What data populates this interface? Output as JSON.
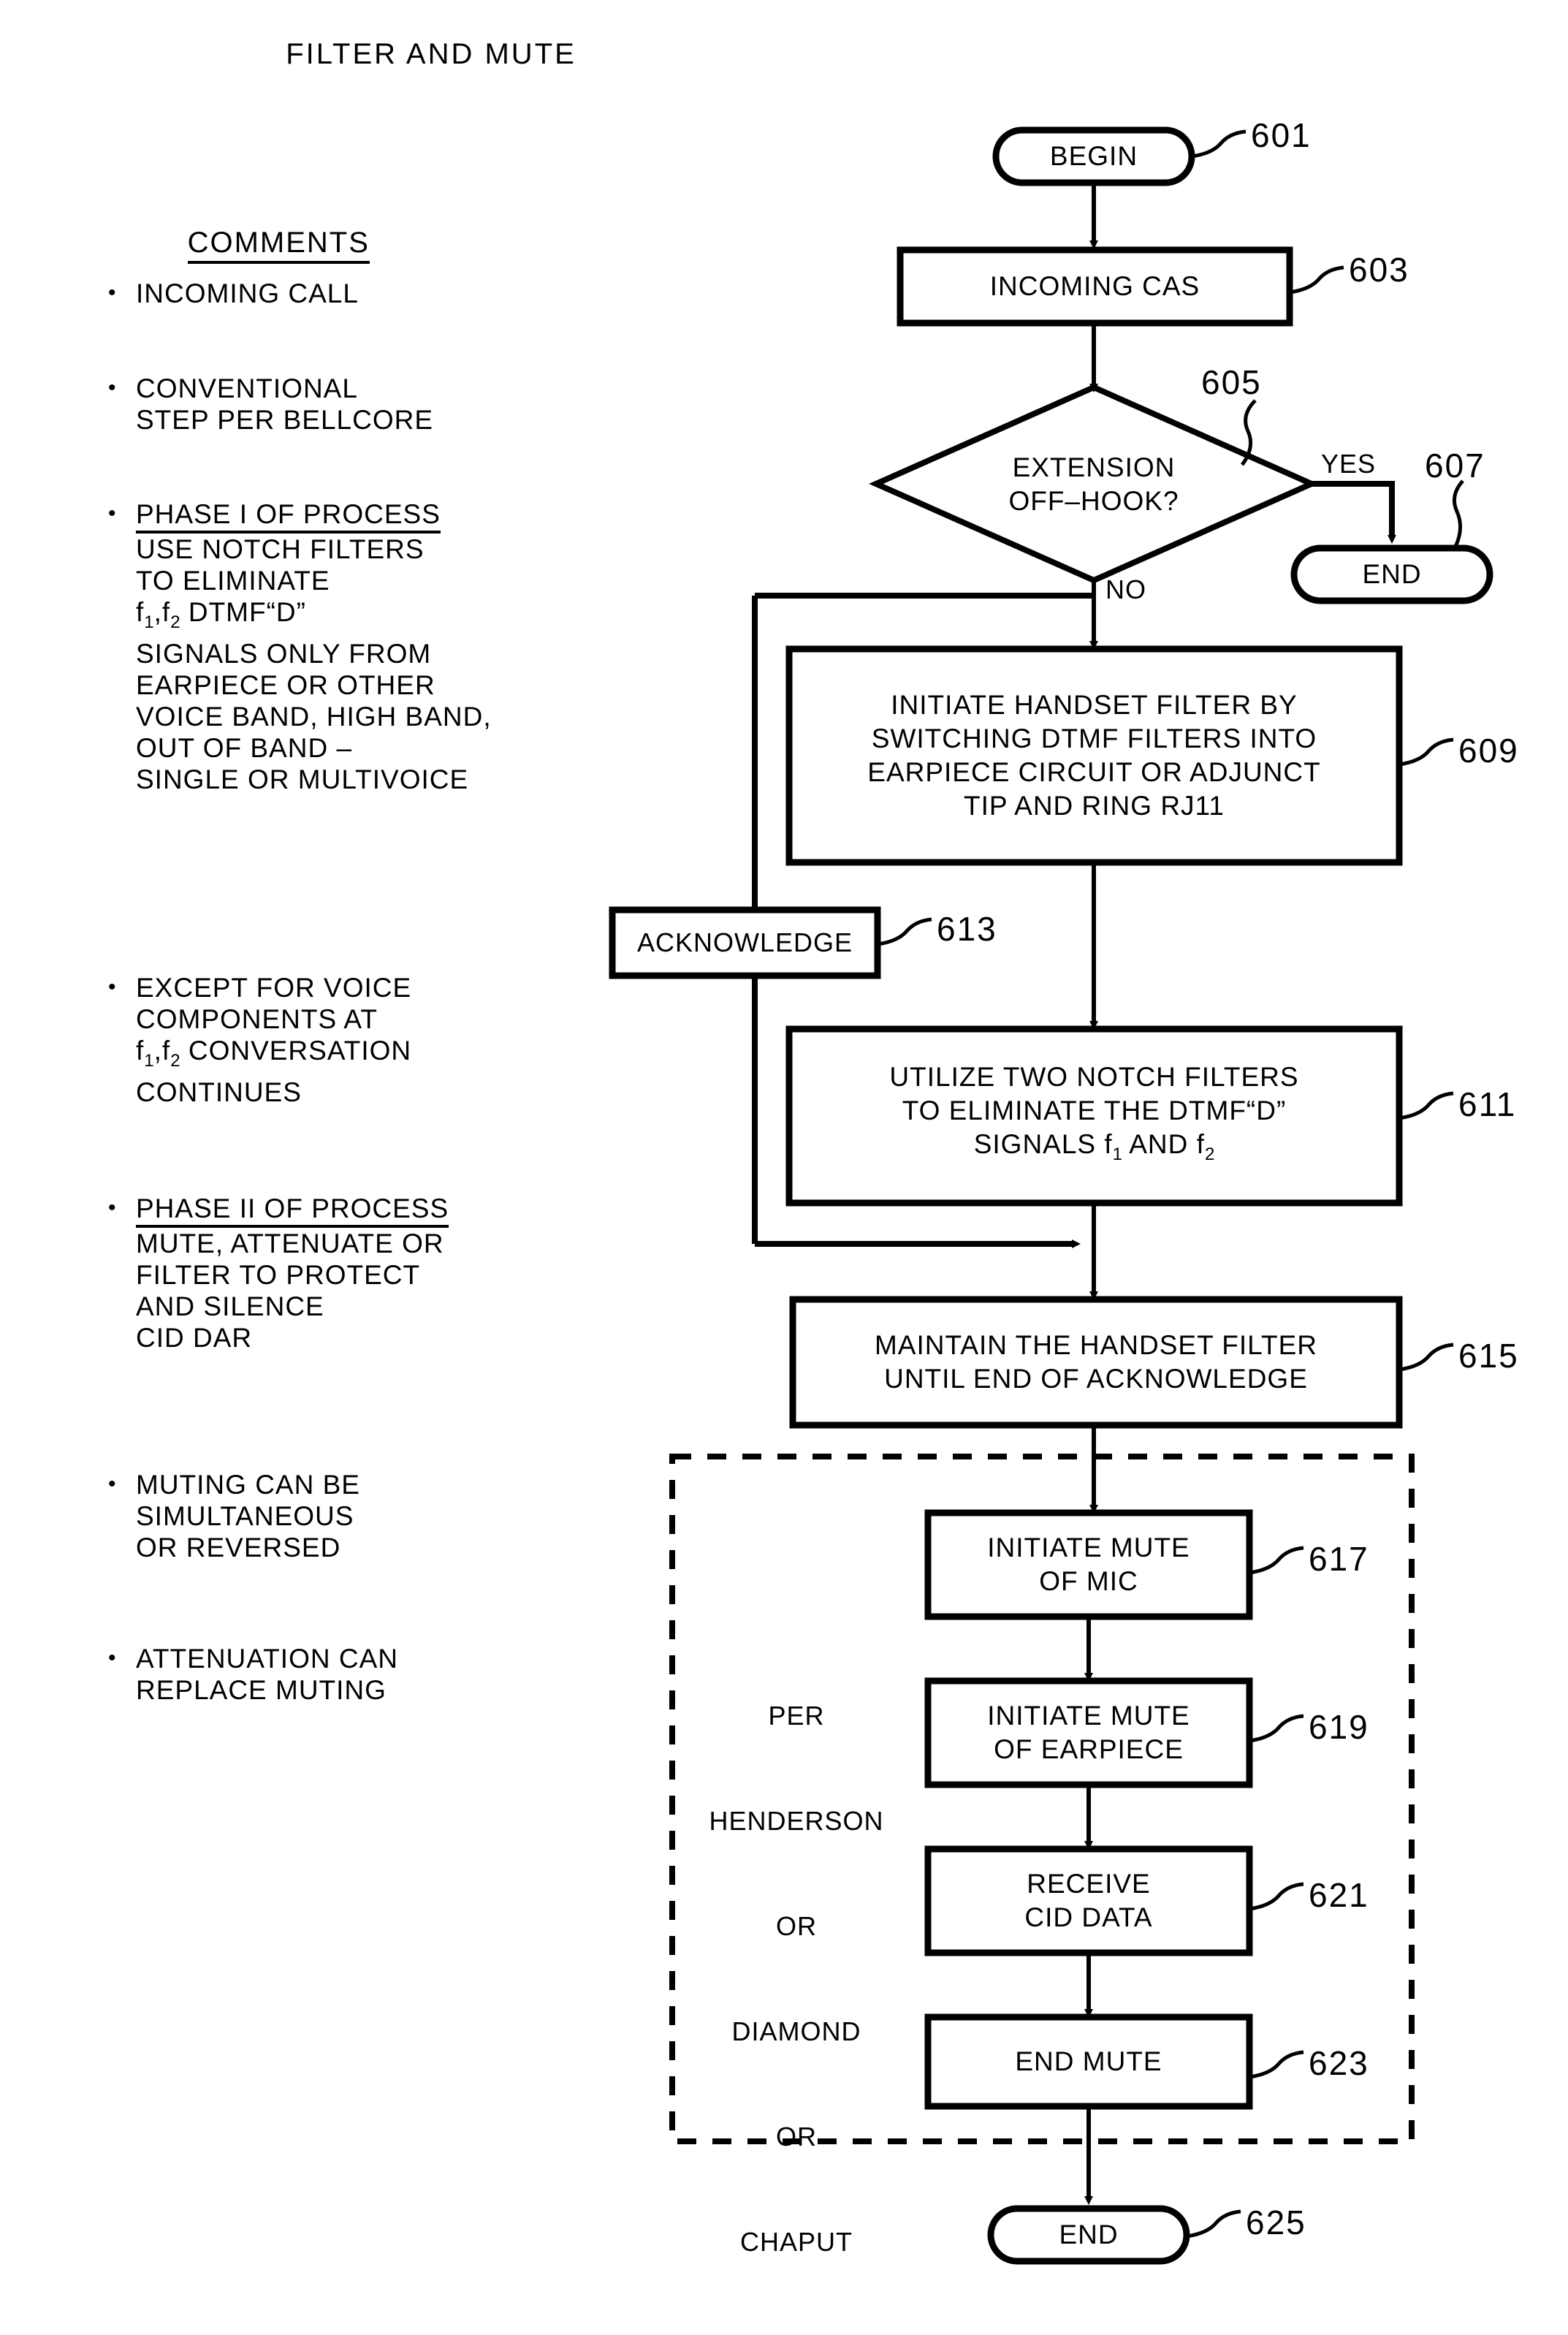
{
  "title": "FILTER AND MUTE",
  "comments": {
    "heading": "COMMENTS",
    "items": [
      {
        "bullet": "•",
        "heading": "",
        "lines": [
          "INCOMING CALL"
        ]
      },
      {
        "bullet": "•",
        "heading": "",
        "lines": [
          "CONVENTIONAL",
          "STEP PER BELLCORE"
        ]
      },
      {
        "bullet": "•",
        "heading": "PHASE I OF PROCESS",
        "lines": [
          "USE NOTCH FILTERS",
          "TO ELIMINATE",
          "f1,f2 DTMF“D”",
          "SIGNALS ONLY FROM",
          "EARPIECE OR OTHER",
          "VOICE BAND, HIGH BAND,",
          "OUT OF BAND –",
          "SINGLE OR MULTIVOICE"
        ]
      },
      {
        "bullet": "•",
        "heading": "",
        "lines": [
          "EXCEPT FOR VOICE",
          "COMPONENTS AT",
          "f1,f2 CONVERSATION",
          "CONTINUES"
        ]
      },
      {
        "bullet": "•",
        "heading": "PHASE II OF PROCESS",
        "lines": [
          "MUTE, ATTENUATE OR",
          "FILTER TO PROTECT",
          "AND SILENCE",
          "CID DAR"
        ]
      },
      {
        "bullet": "•",
        "heading": "",
        "lines": [
          "MUTING CAN BE",
          "SIMULTANEOUS",
          "OR REVERSED"
        ]
      },
      {
        "bullet": "•",
        "heading": "",
        "lines": [
          "ATTENUATION CAN",
          "REPLACE MUTING"
        ]
      }
    ]
  },
  "flow": {
    "nodes": {
      "begin": {
        "label": "BEGIN",
        "ref": "601"
      },
      "incoming_cas": {
        "label": "INCOMING CAS",
        "ref": "603"
      },
      "decision": {
        "label_line1": "EXTENSION",
        "label_line2": "OFF–HOOK?",
        "ref": "605"
      },
      "end_yes": {
        "label": "END",
        "ref": "607"
      },
      "initiate_filter": {
        "line1": "INITIATE HANDSET FILTER BY",
        "line2": "SWITCHING DTMF FILTERS INTO",
        "line3": "EARPIECE CIRCUIT OR ADJUNCT",
        "line4": "TIP AND RING RJ11",
        "ref": "609"
      },
      "acknowledge": {
        "label": "ACKNOWLEDGE",
        "ref": "613"
      },
      "notch": {
        "line1": "UTILIZE TWO NOTCH FILTERS",
        "line2": "TO ELIMINATE THE DTMF“D”",
        "line3": "SIGNALS f1 AND f2",
        "ref": "611"
      },
      "maintain": {
        "line1": "MAINTAIN THE HANDSET FILTER",
        "line2": "UNTIL END OF ACKNOWLEDGE",
        "ref": "615"
      },
      "mute_mic": {
        "line1": "INITIATE MUTE",
        "line2": "OF MIC",
        "ref": "617"
      },
      "mute_earpiece": {
        "line1": "INITIATE MUTE",
        "line2": "OF EARPIECE",
        "ref": "619"
      },
      "receive_cid": {
        "line1": "RECEIVE",
        "line2": "CID DATA",
        "ref": "621"
      },
      "end_mute": {
        "label": "END MUTE",
        "ref": "623"
      },
      "end_final": {
        "label": "END",
        "ref": "625"
      }
    },
    "edge_labels": {
      "yes": "YES",
      "no": "NO"
    },
    "group_label": {
      "lines": [
        "PER",
        "HENDERSON",
        "OR",
        "DIAMOND",
        "OR",
        "CHAPUT"
      ]
    }
  },
  "colors": {
    "ink": "#000000",
    "paper": "#ffffff"
  }
}
